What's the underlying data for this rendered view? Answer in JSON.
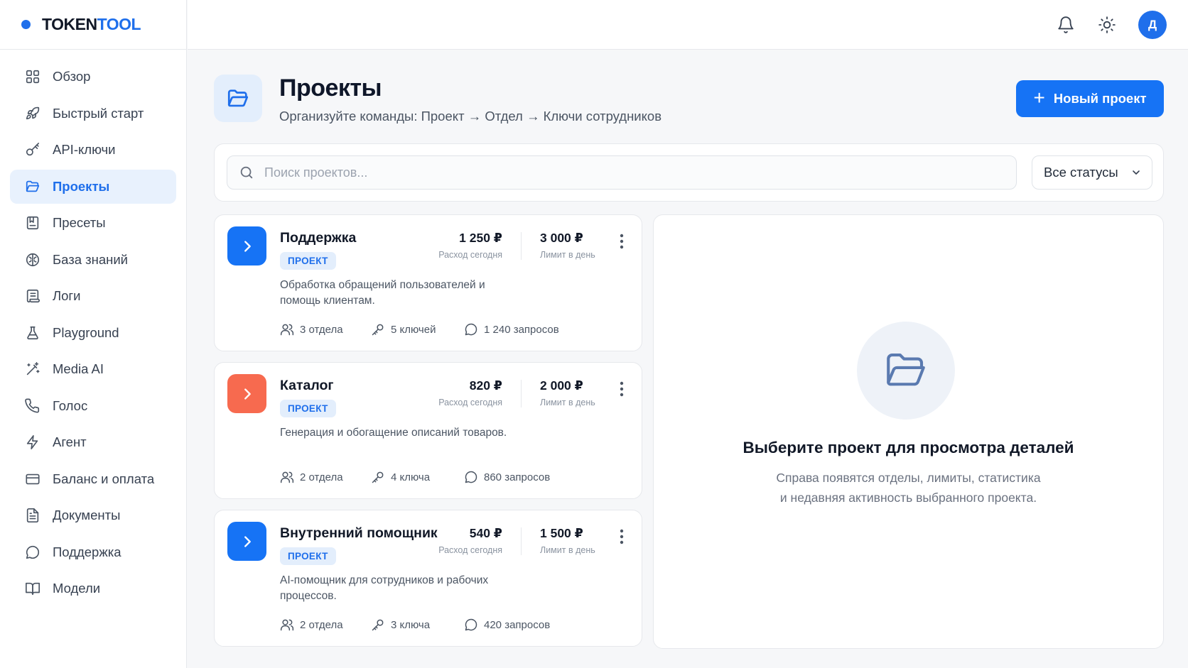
{
  "brand": {
    "name_part1": "TOKEN",
    "name_part2": "TOOL",
    "accent": "#1f6feb"
  },
  "sidebar": {
    "items": [
      {
        "label": "Обзор",
        "icon": "grid-icon"
      },
      {
        "label": "Быстрый старт",
        "icon": "rocket-icon"
      },
      {
        "label": "API-ключи",
        "icon": "key-icon"
      },
      {
        "label": "Проекты",
        "icon": "folder-icon",
        "active": true
      },
      {
        "label": "Пресеты",
        "icon": "preset-icon"
      },
      {
        "label": "База знаний",
        "icon": "brain-icon"
      },
      {
        "label": "Логи",
        "icon": "logs-icon"
      },
      {
        "label": "Playground",
        "icon": "flask-icon"
      },
      {
        "label": "Media AI",
        "icon": "magic-wand-icon"
      },
      {
        "label": "Голос",
        "icon": "phone-icon"
      },
      {
        "label": "Агент",
        "icon": "lightning-icon"
      },
      {
        "label": "Баланс и оплата",
        "icon": "credit-card-icon"
      },
      {
        "label": "Документы",
        "icon": "document-icon"
      },
      {
        "label": "Поддержка",
        "icon": "chat-bubble-icon"
      },
      {
        "label": "Модели",
        "icon": "book-icon"
      }
    ]
  },
  "topbar": {
    "avatar_initial": "Д"
  },
  "header": {
    "title": "Проекты",
    "subtitle": "Организуйте команды: Проект → Отдел → Ключи сотрудников",
    "new_button": "Новый проект"
  },
  "filters": {
    "search_placeholder": "Поиск проектов...",
    "status_value": "Все статусы"
  },
  "projects": [
    {
      "name": "Поддержка",
      "badge": "ПРОЕКТ",
      "description": "Обработка обращений пользователей и помощь клиентам.",
      "spend_value": "1 250 ₽",
      "spend_label": "Расход сегодня",
      "limit_value": "3 000 ₽",
      "limit_label": "Лимит в день",
      "departments": "3 отдела",
      "keys": "5 ключей",
      "requests": "1 240 запросов",
      "color": "#1673f5"
    },
    {
      "name": "Каталог",
      "badge": "ПРОЕКТ",
      "description": "Генерация и обогащение описаний товаров.",
      "spend_value": "820 ₽",
      "spend_label": "Расход сегодня",
      "limit_value": "2 000 ₽",
      "limit_label": "Лимит в день",
      "departments": "2 отдела",
      "keys": "4 ключа",
      "requests": "860 запросов",
      "color": "#f76a4f"
    },
    {
      "name": "Внутренний помощник",
      "badge": "ПРОЕКТ",
      "description": "AI-помощник для сотрудников и рабочих процессов.",
      "spend_value": "540 ₽",
      "spend_label": "Расход сегодня",
      "limit_value": "1 500 ₽",
      "limit_label": "Лимит в день",
      "departments": "2 отдела",
      "keys": "3 ключа",
      "requests": "420 запросов",
      "color": "#1673f5"
    }
  ],
  "detail": {
    "title": "Выберите проект для просмотра деталей",
    "line1": "Справа появятся отделы, лимиты, статистика",
    "line2": "и недавняя активность выбранного проекта."
  }
}
